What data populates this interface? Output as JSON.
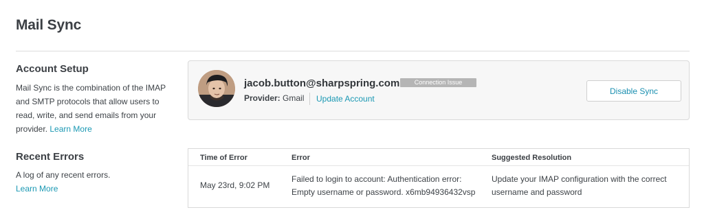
{
  "page": {
    "title": "Mail Sync"
  },
  "account_setup": {
    "heading": "Account Setup",
    "description_lines": [
      "Mail Sync is the combination of the IMAP",
      "and SMTP protocols that allow users to",
      "read, write, and send emails from your",
      "provider."
    ],
    "learn_more": "Learn More"
  },
  "account": {
    "email": "jacob.button@sharpspring.com",
    "status": "Connection Issue",
    "provider_label": "Provider:",
    "provider_value": "Gmail",
    "update_link": "Update Account",
    "disable_button": "Disable Sync"
  },
  "recent_errors": {
    "heading": "Recent Errors",
    "description": "A log of any recent errors.",
    "learn_more": "Learn More"
  },
  "errors_table": {
    "columns": [
      "Time of Error",
      "Error",
      "Suggested Resolution"
    ],
    "rows": [
      {
        "time": "May 23rd, 9:02 PM",
        "error_lines": [
          "Failed to login to account: Authentication error:",
          "Empty username or password. x6mb94936432vsp"
        ],
        "resolution_lines": [
          "Update your IMAP configuration with the correct",
          "username and password"
        ]
      }
    ]
  },
  "colors": {
    "link": "#1a98b3",
    "badge": "#b5b5b5",
    "card_background": "#f7f7f7"
  },
  "icons": {
    "avatar": "user-avatar-photo"
  }
}
